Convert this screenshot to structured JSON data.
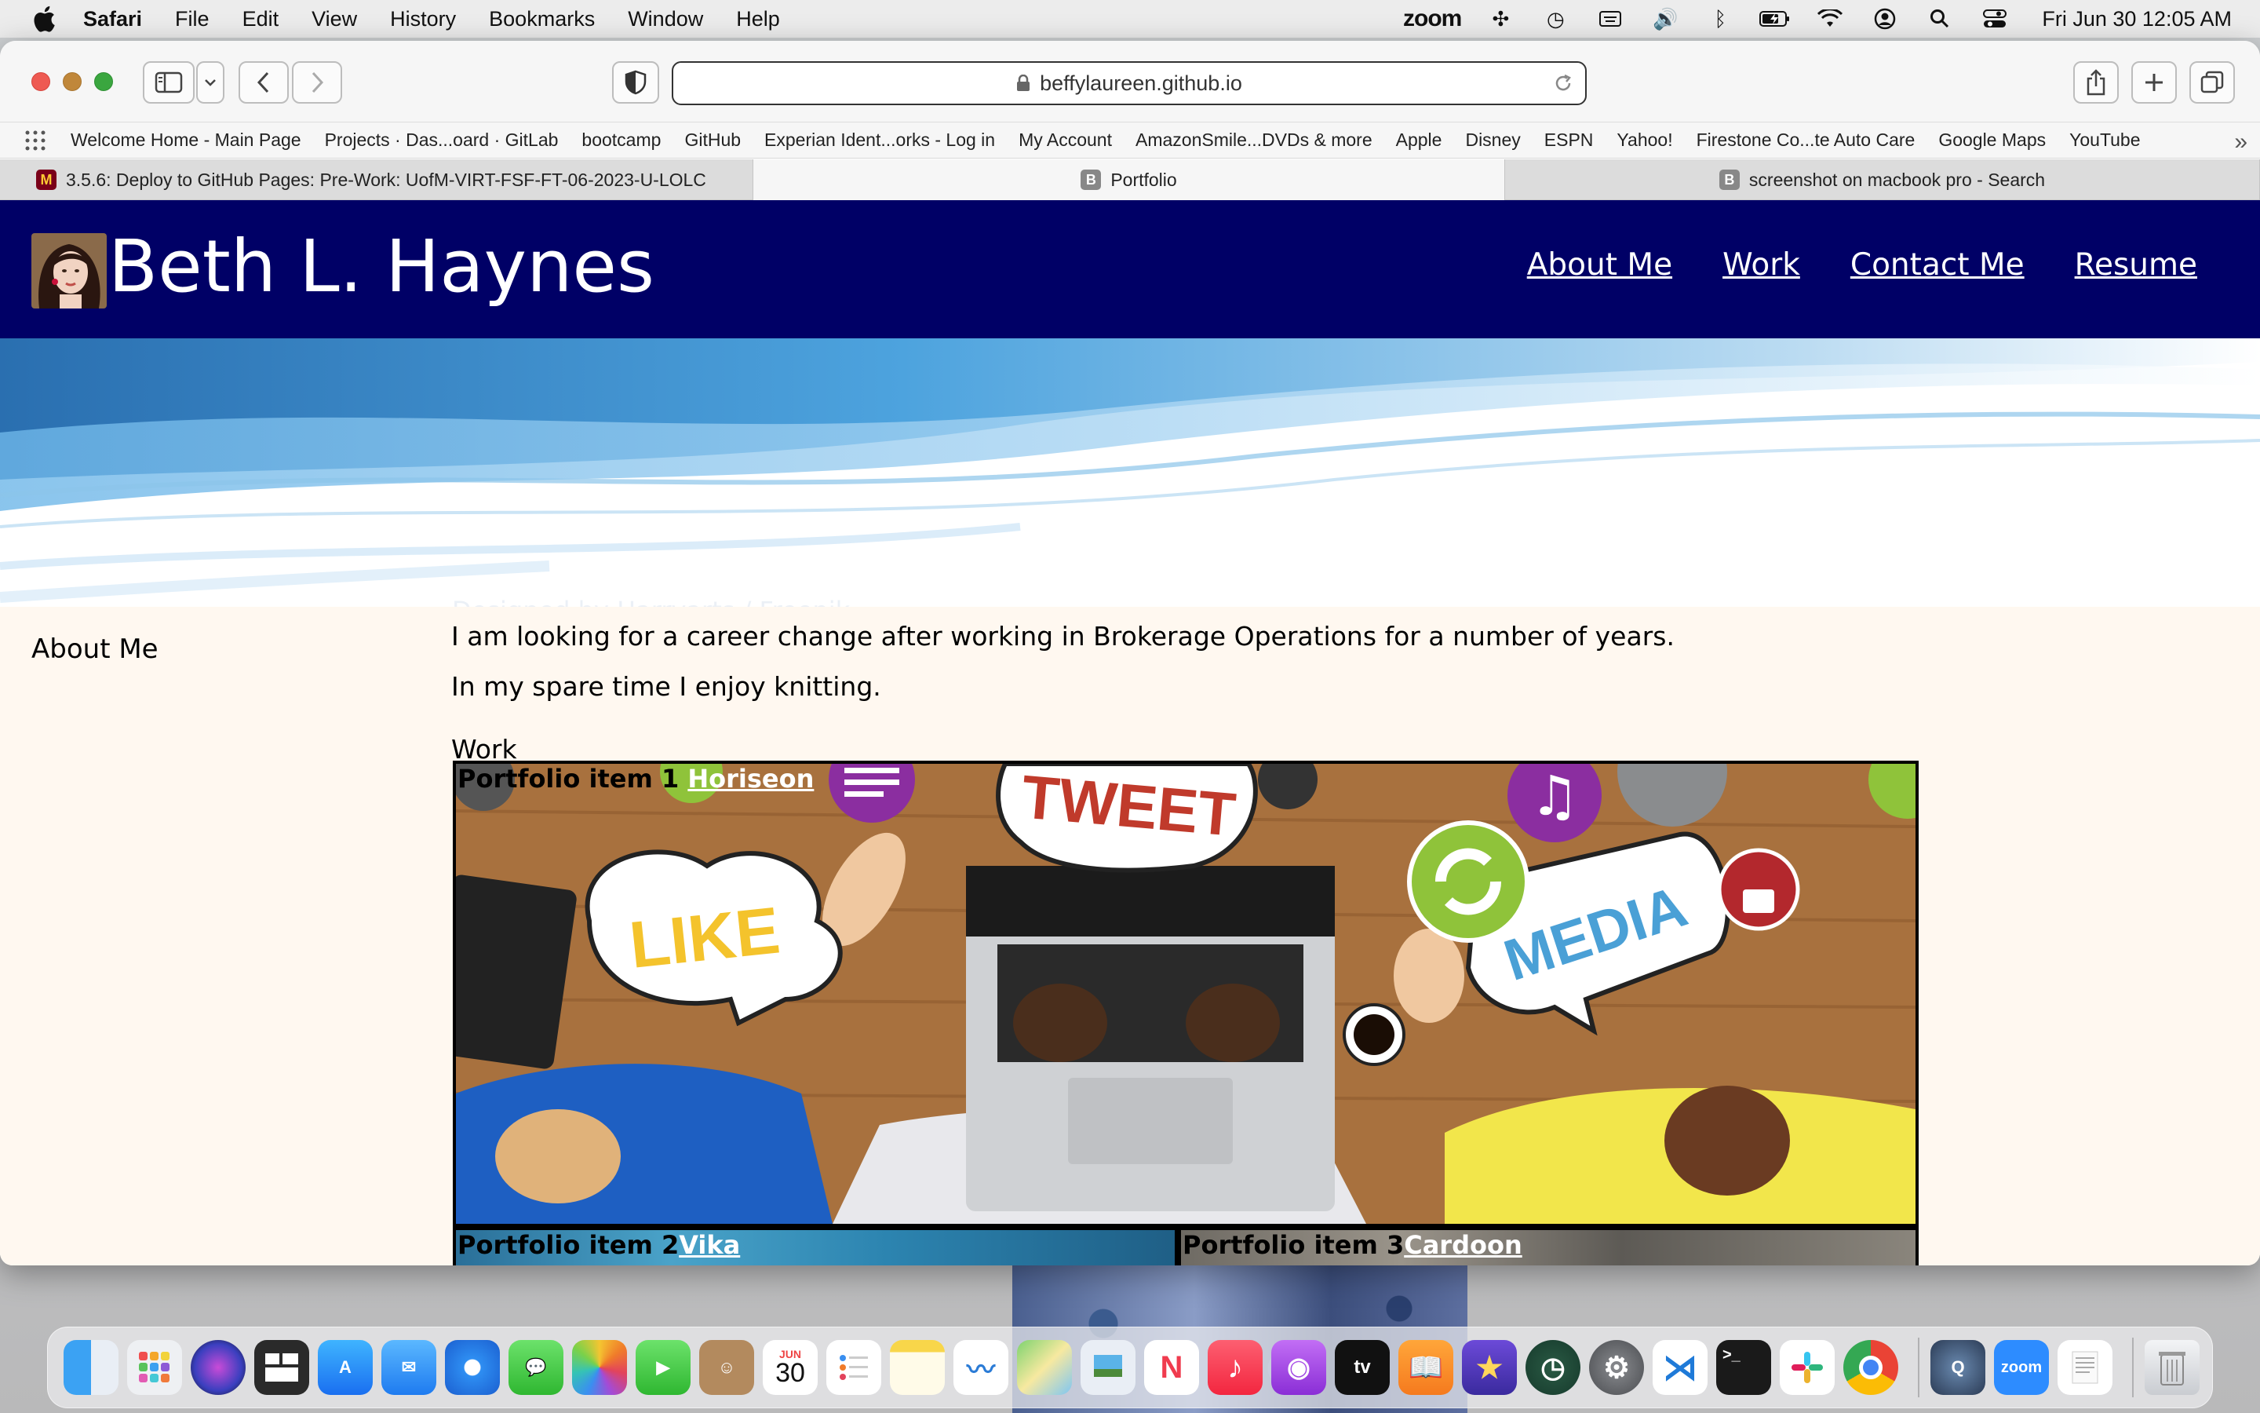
{
  "menubar": {
    "app_name": "Safari",
    "menus": [
      "File",
      "Edit",
      "View",
      "History",
      "Bookmarks",
      "Window",
      "Help"
    ],
    "zoom_label": "zoom",
    "clock": "Fri Jun 30  12:05 AM",
    "status_icons": [
      "grid-dots-icon",
      "time-machine-icon",
      "keyboard-icon",
      "volume-icon",
      "bluetooth-icon",
      "battery-icon",
      "wifi-icon",
      "user-icon",
      "search-icon",
      "control-center-icon"
    ]
  },
  "browser": {
    "url": "beffylaureen.github.io",
    "favorites": [
      "Welcome Home - Main Page",
      "Projects · Das...oard · GitLab",
      "bootcamp",
      "GitHub",
      "Experian Ident...orks - Log in",
      "My Account",
      "AmazonSmile...DVDs & more",
      "Apple",
      "Disney",
      "ESPN",
      "Yahoo!",
      "Firestone Co...te Auto Care",
      "Google Maps",
      "YouTube"
    ],
    "tabs": [
      {
        "title": "3.5.6: Deploy to GitHub Pages: Pre-Work: UofM-VIRT-FSF-FT-06-2023-U-LOLC",
        "icon": "M",
        "active": false
      },
      {
        "title": "Portfolio",
        "icon": "B",
        "active": true
      },
      {
        "title": "screenshot on macbook pro - Search",
        "icon": "B",
        "active": false
      }
    ]
  },
  "site": {
    "name": "Beth L. Haynes",
    "nav": [
      "About Me",
      "Work",
      "Contact Me",
      "Resume"
    ],
    "hero_credit": "Designed by Harryarts / Freepik",
    "about_heading": "About Me",
    "paragraphs": [
      "I am looking for a career change after working in Brokerage Operations for a number of years.",
      "In my spare time I enjoy knitting."
    ],
    "work_heading": "Work",
    "portfolio": [
      {
        "label": "Portfolio item 1",
        "link": "Horiseon"
      },
      {
        "label": "Portfolio item 2",
        "link": "Vika"
      },
      {
        "label": "Portfolio item 3",
        "link": "Cardoon"
      }
    ],
    "image_words": {
      "like": "LIKE",
      "tweet": "TWEET",
      "media": "MEDIA"
    }
  },
  "dock": {
    "calendar_month": "JUN",
    "calendar_day": "30",
    "apps": [
      "finder",
      "launchpad",
      "siri",
      "mission-control",
      "app-store",
      "mail",
      "safari",
      "messages",
      "photos",
      "facetime",
      "contacts",
      "calendar",
      "reminders",
      "notes",
      "freeform",
      "maps",
      "preview",
      "news",
      "music",
      "podcasts",
      "tv",
      "books",
      "imovie",
      "time-machine",
      "system-settings",
      "vscode",
      "terminal",
      "slack",
      "chrome",
      "quicktime",
      "zoom",
      "textedit",
      "trash"
    ],
    "zoom_label": "zoom",
    "tv_label": "tv"
  }
}
